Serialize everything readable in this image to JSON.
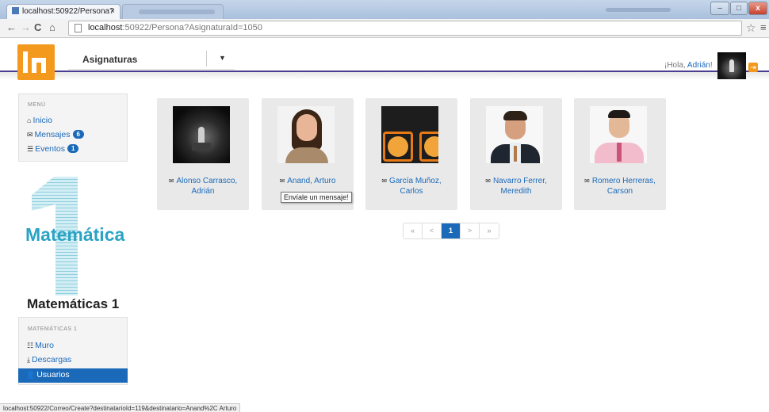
{
  "browser": {
    "active_tab": "localhost:50922/Persona?",
    "close_glyph": "×",
    "url_host": "localhost",
    "url_rest": ":50922/Persona?AsignaturaId=1050",
    "window_buttons": {
      "minimize": "–",
      "maximize": "□",
      "close": "x"
    },
    "status_url": "localhost:50922/Correo/Create?destinatarioId=119&destinatario=Anand%2C Arturo"
  },
  "header": {
    "dropdown_label": "Asignaturas",
    "dropdown_caret": "▼",
    "greeting": "¡Hola, ",
    "user_name": "Adrián",
    "greeting_end": "!"
  },
  "sidebar": {
    "menu_heading": "MENÚ",
    "menu_items": [
      {
        "label": "Inicio",
        "icon": "home-icon"
      },
      {
        "label": "Mensajes",
        "icon": "envelope-icon",
        "badge": "6"
      },
      {
        "label": "Eventos",
        "icon": "list-icon",
        "badge": "1"
      }
    ],
    "subject_image_text": "Matemática",
    "subject_title": "Matemáticas 1",
    "subject_heading": "MATEMÁTICAS 1",
    "subject_items": [
      {
        "label": "Muro",
        "icon": "list-icon"
      },
      {
        "label": "Descargas",
        "icon": "download-icon"
      },
      {
        "label": "Usuarios",
        "icon": "user-icon",
        "active": true
      }
    ]
  },
  "people": [
    {
      "name_line1": "Alonso Carrasco,",
      "name_line2": "Adrián"
    },
    {
      "name_line1": "Anand, Arturo",
      "name_line2": ""
    },
    {
      "name_line1": "García Muñoz,",
      "name_line2": "Carlos"
    },
    {
      "name_line1": "Navarro Ferrer,",
      "name_line2": "Meredith"
    },
    {
      "name_line1": "Romero Herreras,",
      "name_line2": "Carson"
    }
  ],
  "tooltip": "Envíale un mensaje!",
  "pagination": {
    "first": "«",
    "prev": "<",
    "current": "1",
    "next": ">",
    "last": "»"
  },
  "colors": {
    "brand_orange": "#f39a1e",
    "link_blue": "#1b6ab9",
    "header_line": "#4a3d8f"
  }
}
